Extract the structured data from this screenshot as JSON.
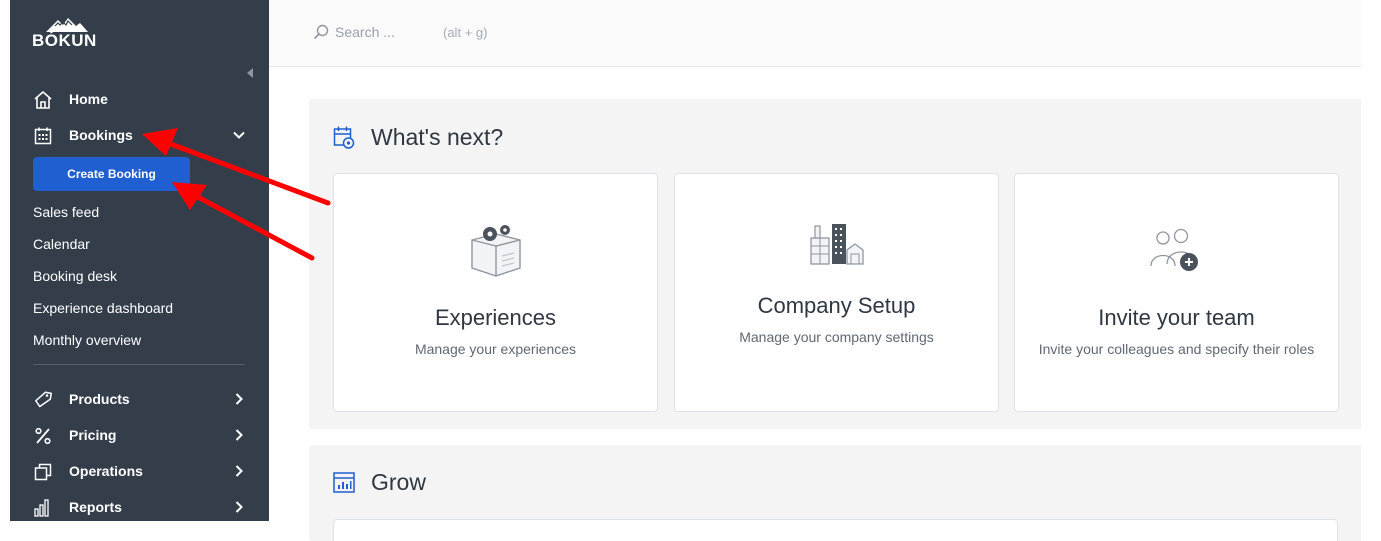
{
  "app": {
    "logo_text": "BÓKUN"
  },
  "sidebar": {
    "nav": [
      {
        "id": "home",
        "label": "Home",
        "icon": "home-icon"
      },
      {
        "id": "bookings",
        "label": "Bookings",
        "icon": "calendar-icon",
        "expanded": true
      }
    ],
    "create_booking_label": "Create Booking",
    "sub_items": [
      "Sales feed",
      "Calendar",
      "Booking desk",
      "Experience dashboard",
      "Monthly overview"
    ],
    "sections": [
      {
        "id": "products",
        "label": "Products",
        "icon": "tag-icon"
      },
      {
        "id": "pricing",
        "label": "Pricing",
        "icon": "percent-icon"
      },
      {
        "id": "operations",
        "label": "Operations",
        "icon": "copy-icon"
      },
      {
        "id": "reports",
        "label": "Reports",
        "icon": "bar-chart-icon"
      }
    ]
  },
  "search": {
    "placeholder": "Search ...",
    "shortcut": "(alt + g)"
  },
  "whats_next": {
    "title": "What's next?",
    "cards": [
      {
        "title": "Experiences",
        "subtitle": "Manage your experiences"
      },
      {
        "title": "Company Setup",
        "subtitle": "Manage your company settings"
      },
      {
        "title": "Invite your team",
        "subtitle": "Invite your colleagues and specify their roles"
      }
    ]
  },
  "grow": {
    "title": "Grow"
  },
  "colors": {
    "sidebar_bg": "#343e4b",
    "primary": "#1f5fd1",
    "annotation_arrow": "#ff0000"
  }
}
